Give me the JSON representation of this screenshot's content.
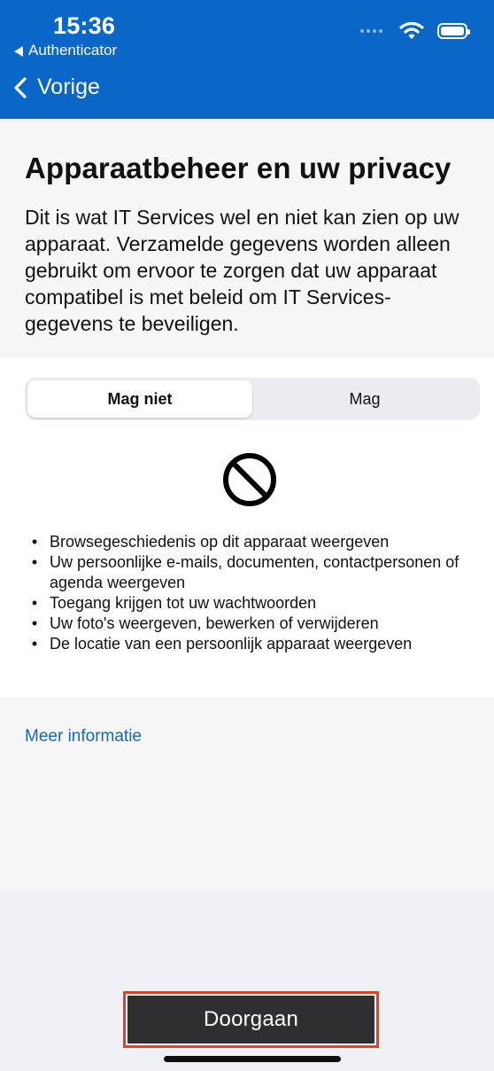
{
  "status_bar": {
    "time": "15:36",
    "back_to_app": "Authenticator"
  },
  "navigation": {
    "back_label": "Vorige"
  },
  "intro": {
    "title": "Apparaatbeheer en uw privacy",
    "description": "Dit is wat IT Services wel en niet kan zien op uw apparaat. Verzamelde gegevens worden alleen gebruikt om ervoor te zorgen dat uw apparaat compatibel is met beleid om IT Services-gegevens te beveiligen."
  },
  "segmented_control": {
    "selected": "Mag niet",
    "options": [
      "Mag niet",
      "Mag"
    ]
  },
  "restrictions": {
    "icon": "prohibited-icon",
    "items": [
      "Browsegeschiedenis op dit apparaat weergeven",
      "Uw persoonlijke e-mails, documenten, contactpersonen of agenda weergeven",
      "Toegang krijgen tot uw wachtwoorden",
      "Uw foto's weergeven, bewerken of verwijderen",
      "De locatie van een persoonlijk apparaat weergeven"
    ]
  },
  "links": {
    "more_info": "Meer informatie"
  },
  "actions": {
    "continue_label": "Doorgaan"
  },
  "colors": {
    "header_background": "#0A67C8",
    "link": "#1468B5",
    "button_background": "#2F2F31",
    "button_highlight": "#EE3A1D"
  }
}
